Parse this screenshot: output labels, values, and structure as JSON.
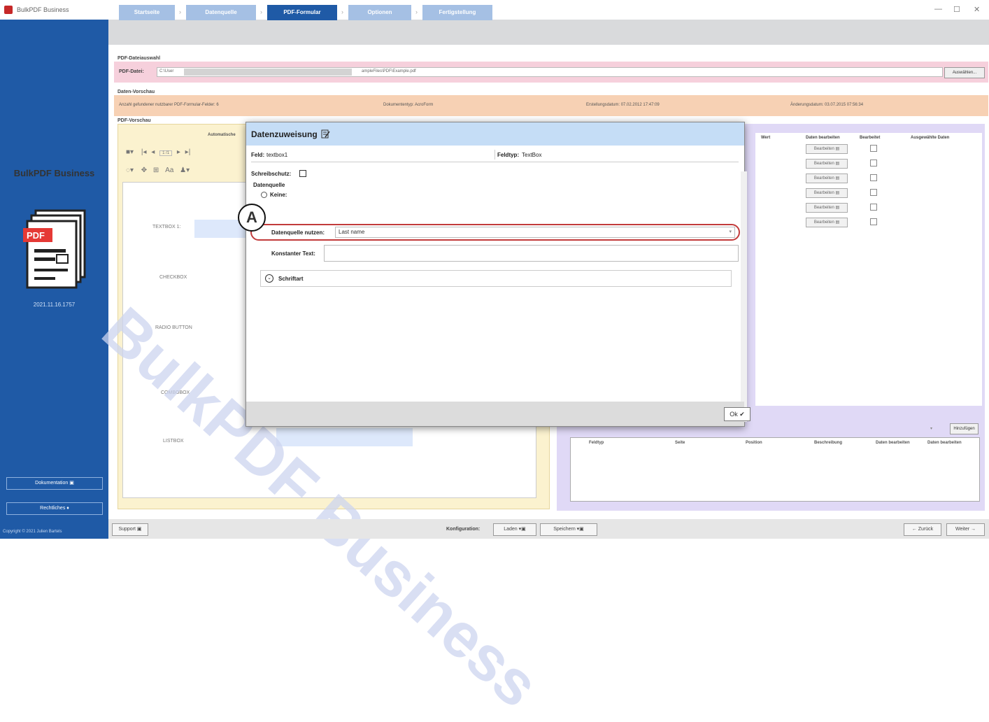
{
  "app": {
    "window_title": "BulkPDF Business",
    "brand": "BulkPDF Business",
    "version": "2021.11.16.1757",
    "copyright": "Copyright © 2021 Julien Bartels"
  },
  "sidebar": {
    "doc_button": "Dokumentation",
    "legal_button": "Rechtliches"
  },
  "steps": [
    "Startseite",
    "Datenquelle",
    "PDF-Formular",
    "Optionen",
    "Fertigstellung"
  ],
  "file_section": {
    "title": "PDF-Dateiauswahl",
    "label": "PDF-Datei:",
    "path_start": "C:\\User",
    "path_end": "ampleFiles\\PDF\\Example.pdf",
    "choose_button": "Auswählen..."
  },
  "data_preview": {
    "title": "Daten-Vorschau",
    "fields_found": "Anzahl gefundener nutzbarer PDF-Formular-Felder: 6",
    "doctype": "Dokumententyp: AcroForm",
    "created": "Erstellungsdatum: 07.02.2012 17:47:09",
    "modified": "Änderungsdatum: 03.07.2015 07:56:34"
  },
  "pdf_preview": {
    "title": "PDF-Vorschau",
    "auto_label": "Automatische",
    "page_indicator": "1 /1",
    "labels": [
      "TEXTBOX 1:",
      "CHECKBOX",
      "RADIO BUTTON",
      "COMBOBOX",
      "LISTBOX"
    ],
    "watermark": "BulkPDF Business"
  },
  "field_grid": {
    "headers": [
      "Wert",
      "Daten bearbeiten",
      "Bearbeitet",
      "Ausgewählte Daten"
    ],
    "edit_label": "Bearbeiten"
  },
  "lower_table": {
    "headers": [
      "Feldtyp",
      "Seite",
      "Position",
      "Beschreibung",
      "Daten bearbeiten",
      "Daten bearbeiten"
    ],
    "add_button": "Hinzufügen"
  },
  "bottom": {
    "support": "Support",
    "config_label": "Konfiguration:",
    "load": "Laden",
    "save": "Speichern",
    "back": "← Zurück",
    "next": "Weiter →"
  },
  "dialog": {
    "title": "Datenzuweisung",
    "field_label": "Feld:",
    "field_value": "textbox1",
    "fieldtype_label": "Feldtyp:",
    "fieldtype_value": "TextBox",
    "readonly_label": "Schreibschutz:",
    "source_group": "Datenquelle",
    "none_label": "Keine:",
    "use_source_label": "Datenquelle nutzen:",
    "selected_source": "Last name",
    "constant_label": "Konstanter Text:",
    "constant_value": "",
    "font_label": "Schriftart",
    "ok_button": "Ok"
  },
  "callout": "A"
}
